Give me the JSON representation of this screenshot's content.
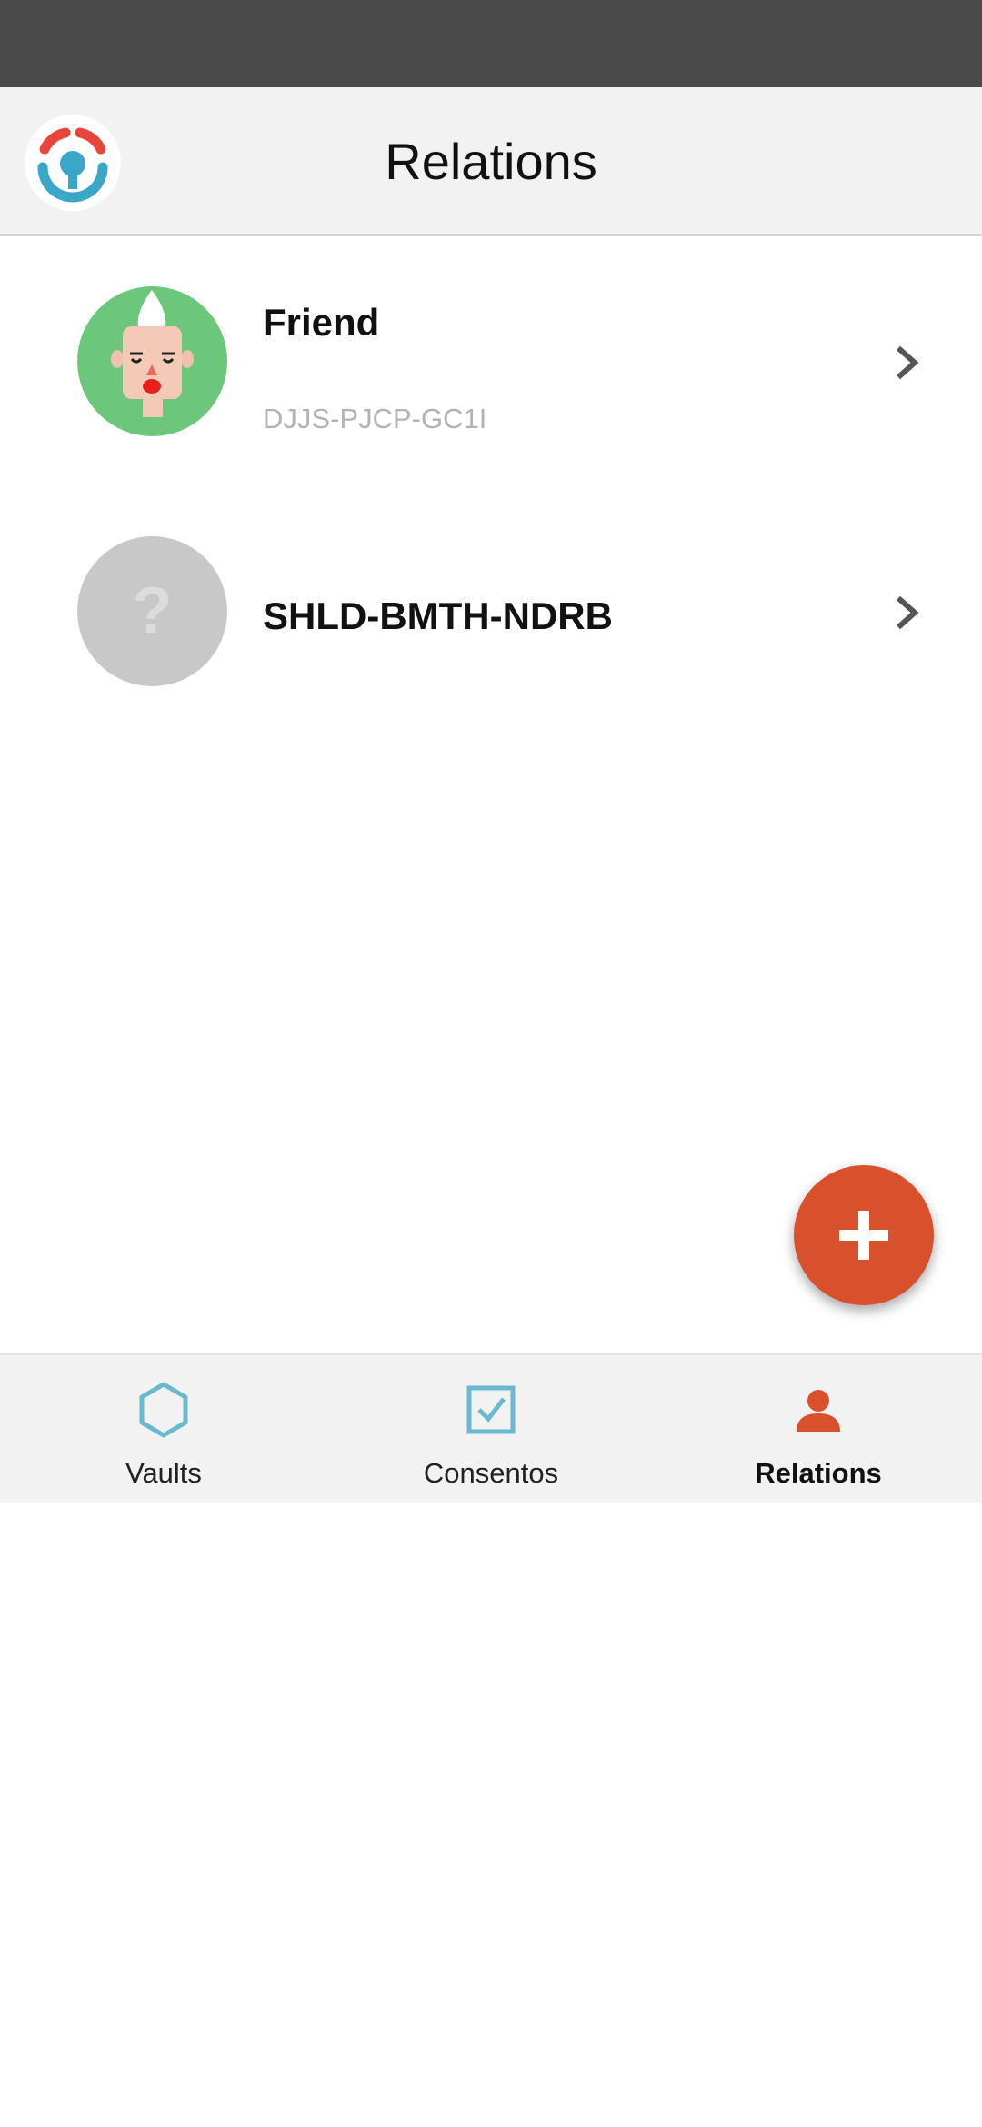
{
  "header": {
    "title": "Relations",
    "logo_icon": "app-logo-icon"
  },
  "relations": [
    {
      "name": "Friend",
      "code": "DJJS-PJCP-GC1I",
      "avatar_icon": "face-avatar-icon",
      "avatar_color": "#6dc77b"
    },
    {
      "name": "SHLD-BMTH-NDRB",
      "code": "",
      "avatar_icon": "unknown-avatar-icon",
      "avatar_placeholder": "?",
      "avatar_color": "#c8c8c8"
    }
  ],
  "fab": {
    "icon": "plus-icon",
    "color": "#d9502d"
  },
  "bottom_nav": {
    "items": [
      {
        "label": "Vaults",
        "icon": "hexagon-icon",
        "active": false
      },
      {
        "label": "Consentos",
        "icon": "checkbox-icon",
        "active": false
      },
      {
        "label": "Relations",
        "icon": "person-icon",
        "active": true
      }
    ]
  },
  "colors": {
    "accent": "#d9502d",
    "nav_icon_inactive": "#6ab9cf",
    "header_bg": "#f2f2f2",
    "status_bar": "#4a4a4a"
  }
}
